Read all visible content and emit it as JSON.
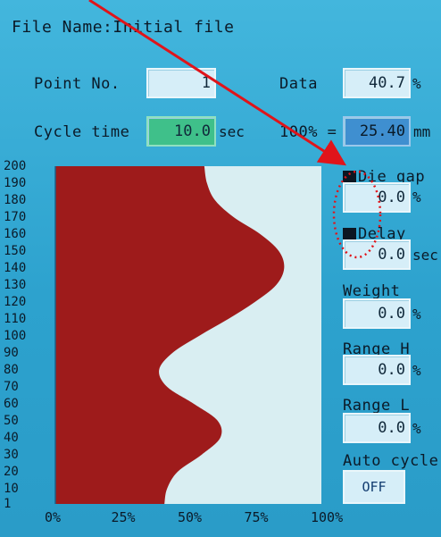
{
  "header": {
    "file_name_label": "File Name:",
    "file_name_value": "Initial file"
  },
  "fields": {
    "point_no_label": "Point No.",
    "point_no_value": "1",
    "data_label": "Data",
    "data_value": "40.7",
    "data_unit": "%",
    "cycle_time_label": "Cycle time",
    "cycle_time_value": "10.0",
    "cycle_time_unit": "sec",
    "scale_label": "100% =",
    "scale_value": "25.40",
    "scale_unit": "mm"
  },
  "side_panel": {
    "die_gap_label": "Die gap",
    "die_gap_value": "0.0",
    "die_gap_unit": "%",
    "delay_label": "Delay",
    "delay_value": "0.0",
    "delay_unit": "sec",
    "weight_label": "Weight",
    "weight_value": "0.0",
    "weight_unit": "%",
    "range_h_label": "Range H",
    "range_h_value": "0.0",
    "range_h_unit": "%",
    "range_l_label": "Range L",
    "range_l_value": "0.0",
    "range_l_unit": "%",
    "auto_cycle_label": "Auto cycle",
    "auto_cycle_value": "OFF"
  },
  "chart_data": {
    "type": "area",
    "orientation": "horizontal",
    "y_ticks": [
      "200",
      "190",
      "180",
      "170",
      "160",
      "150",
      "140",
      "130",
      "120",
      "110",
      "100",
      "90",
      "80",
      "70",
      "60",
      "50",
      "40",
      "30",
      "20",
      "10",
      "1"
    ],
    "x_ticks": [
      "0%",
      "25%",
      "50%",
      "75%",
      "100%"
    ],
    "ylim": [
      1,
      200
    ],
    "xlim": [
      0,
      100
    ],
    "fill_color": "#9e1b1b",
    "background_color": "#d9eef2",
    "points": [
      {
        "y": 1,
        "x": 41
      },
      {
        "y": 10,
        "x": 42
      },
      {
        "y": 20,
        "x": 46
      },
      {
        "y": 30,
        "x": 55
      },
      {
        "y": 40,
        "x": 62
      },
      {
        "y": 50,
        "x": 61
      },
      {
        "y": 60,
        "x": 52
      },
      {
        "y": 70,
        "x": 42
      },
      {
        "y": 80,
        "x": 39
      },
      {
        "y": 90,
        "x": 44
      },
      {
        "y": 100,
        "x": 54
      },
      {
        "y": 110,
        "x": 65
      },
      {
        "y": 120,
        "x": 75
      },
      {
        "y": 130,
        "x": 83
      },
      {
        "y": 140,
        "x": 86
      },
      {
        "y": 150,
        "x": 84
      },
      {
        "y": 160,
        "x": 77
      },
      {
        "y": 170,
        "x": 67
      },
      {
        "y": 180,
        "x": 60
      },
      {
        "y": 190,
        "x": 57
      },
      {
        "y": 200,
        "x": 56
      }
    ]
  },
  "annotation": {
    "arrow_color": "#e0141a",
    "circle_color": "#e0141a"
  }
}
